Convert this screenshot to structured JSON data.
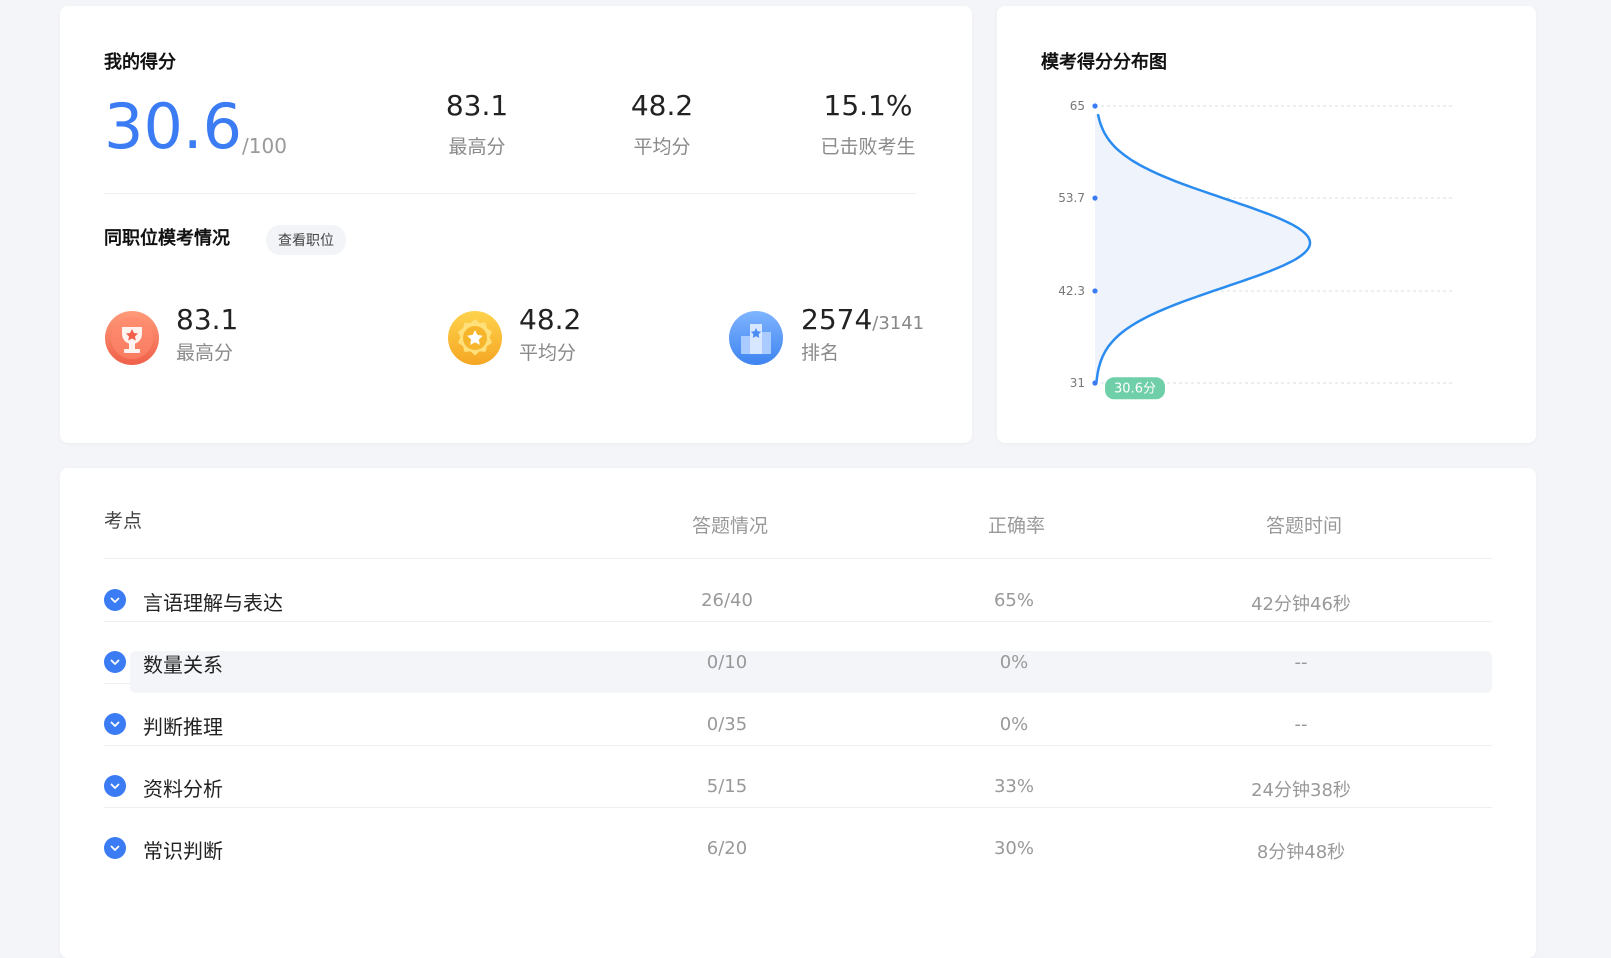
{
  "score_card": {
    "title": "我的得分",
    "score": "30.6",
    "full_mark": "/100",
    "stats": [
      {
        "value": "83.1",
        "label": "最高分"
      },
      {
        "value": "48.2",
        "label": "平均分"
      },
      {
        "value": "15.1%",
        "label": "已击败考生"
      }
    ],
    "peer_title": "同职位模考情况",
    "peer_button": "查看职位",
    "peer_stats": [
      {
        "value": "83.1",
        "label": "最高分",
        "icon": "trophy-icon"
      },
      {
        "value": "48.2",
        "label": "平均分",
        "icon": "medal-star-icon"
      },
      {
        "value": "2574",
        "sub": "/3141",
        "label": "排名",
        "icon": "ranking-icon"
      }
    ]
  },
  "distribution": {
    "title": "模考得分分布图",
    "marker_label": "30.6分"
  },
  "chart_data": {
    "type": "area",
    "title": "模考得分分布图",
    "y_ticks": [
      "65",
      "53.7",
      "42.3",
      "31"
    ],
    "ylim": [
      31,
      65
    ],
    "mean": 48.2,
    "marker": {
      "value": 30.6,
      "label": "30.6分"
    },
    "accent": "#2b8cf0",
    "fill": "#eef3fc",
    "marker_color": "#6fcfa8"
  },
  "table": {
    "headers": [
      "考点",
      "答题情况",
      "正确率",
      "答题时间"
    ],
    "rows": [
      {
        "name": "言语理解与表达",
        "answered": "26/40",
        "rate": "65%",
        "time": "42分钟46秒"
      },
      {
        "name": "数量关系",
        "answered": "0/10",
        "rate": "0%",
        "time": "--"
      },
      {
        "name": "判断推理",
        "answered": "0/35",
        "rate": "0%",
        "time": "--"
      },
      {
        "name": "资料分析",
        "answered": "5/15",
        "rate": "33%",
        "time": "24分钟38秒"
      },
      {
        "name": "常识判断",
        "answered": "6/20",
        "rate": "30%",
        "time": "8分钟48秒"
      }
    ]
  },
  "colors": {
    "accent": "#3b7bf4",
    "page_bg": "#f4f5f8"
  }
}
